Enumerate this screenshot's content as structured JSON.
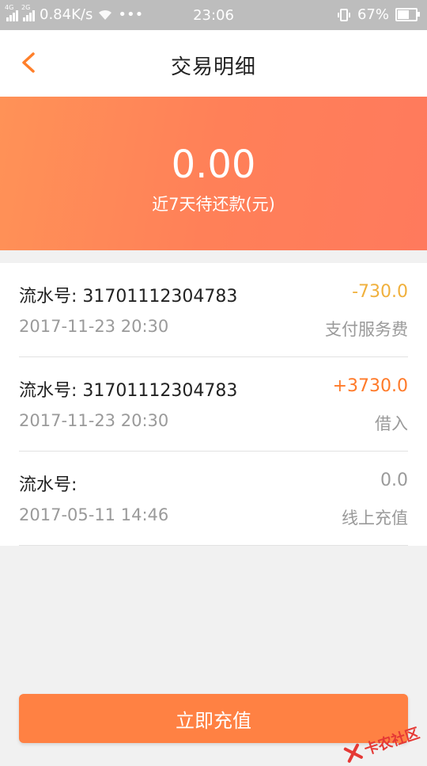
{
  "status_bar": {
    "network_speed": "0.84K/s",
    "time": "23:06",
    "battery": "67%",
    "signal_left": "4G",
    "signal_right": "2G"
  },
  "header": {
    "title": "交易明细"
  },
  "banner": {
    "amount": "0.00",
    "label": "近7天待还款(元)"
  },
  "transactions": [
    {
      "serial": "流水号: 31701112304783",
      "amount": "-730.0",
      "amount_color": "#f0b03c",
      "date": "2017-11-23 20:30",
      "type": "支付服务费"
    },
    {
      "serial": "流水号: 31701112304783",
      "amount": "+3730.0",
      "amount_color": "#ff7a29",
      "date": "2017-11-23 20:30",
      "type": "借入"
    },
    {
      "serial": "流水号:",
      "amount": "0.0",
      "amount_color": "#9a9a9a",
      "date": "2017-05-11 14:46",
      "type": "线上充值"
    }
  ],
  "footer": {
    "button_label": "立即充值"
  },
  "watermark": {
    "text": "卡农社区"
  },
  "colors": {
    "accent": "#ff8143",
    "banner_start": "#ff9257",
    "banner_end": "#ff7a5d"
  }
}
